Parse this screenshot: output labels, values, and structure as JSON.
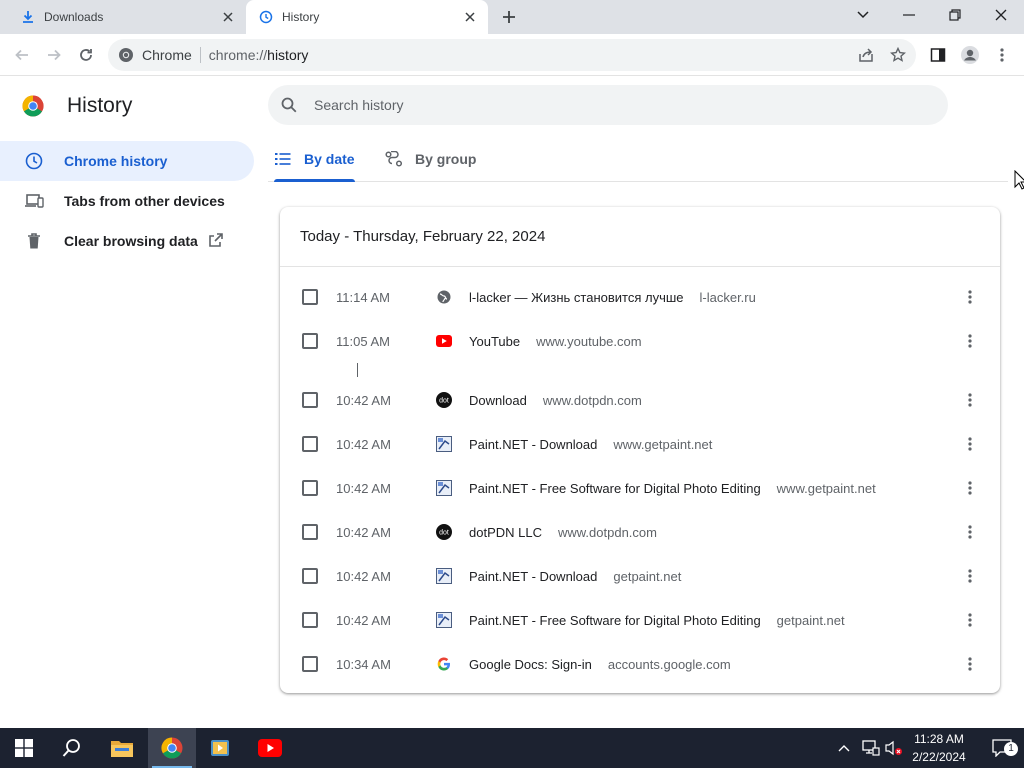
{
  "browser": {
    "tabs": [
      {
        "title": "Downloads",
        "icon": "download-icon",
        "active": false
      },
      {
        "title": "History",
        "icon": "history-icon",
        "active": true
      }
    ],
    "omnibox": {
      "chip": "Chrome",
      "url_scheme": "chrome://",
      "url_host": "history"
    }
  },
  "sidebar": {
    "title": "History",
    "items": [
      {
        "label": "Chrome history",
        "icon": "clock-icon",
        "selected": true
      },
      {
        "label": "Tabs from other devices",
        "icon": "devices-icon",
        "selected": false
      },
      {
        "label": "Clear browsing data",
        "icon": "trash-icon",
        "selected": false
      }
    ]
  },
  "search": {
    "placeholder": "Search history"
  },
  "view_tabs": [
    {
      "label": "By date",
      "icon": "list-icon",
      "active": true
    },
    {
      "label": "By group",
      "icon": "group-icon",
      "active": false
    }
  ],
  "history": {
    "header": "Today - Thursday, February 22, 2024",
    "entries": [
      {
        "time": "11:14 AM",
        "title": "l-lacker — Жизнь становится лучше",
        "domain": "l-lacker.ru",
        "favicon": "globe-icon"
      },
      {
        "time": "11:05 AM",
        "title": "YouTube",
        "domain": "www.youtube.com",
        "favicon": "youtube-icon"
      },
      {
        "time": "10:42 AM",
        "title": "Download",
        "domain": "www.dotpdn.com",
        "favicon": "dotpdn-icon"
      },
      {
        "time": "10:42 AM",
        "title": "Paint.NET - Download",
        "domain": "www.getpaint.net",
        "favicon": "paintnet-icon"
      },
      {
        "time": "10:42 AM",
        "title": "Paint.NET - Free Software for Digital Photo Editing",
        "domain": "www.getpaint.net",
        "favicon": "paintnet-icon"
      },
      {
        "time": "10:42 AM",
        "title": "dotPDN LLC",
        "domain": "www.dotpdn.com",
        "favicon": "dotpdn-icon"
      },
      {
        "time": "10:42 AM",
        "title": "Paint.NET - Download",
        "domain": "getpaint.net",
        "favicon": "paintnet-icon"
      },
      {
        "time": "10:42 AM",
        "title": "Paint.NET - Free Software for Digital Photo Editing",
        "domain": "getpaint.net",
        "favicon": "paintnet-icon"
      },
      {
        "time": "10:34 AM",
        "title": "Google Docs: Sign-in",
        "domain": "accounts.google.com",
        "favicon": "google-icon"
      }
    ]
  },
  "taskbar": {
    "clock_time": "11:28 AM",
    "clock_date": "2/22/2024",
    "notification_count": "1"
  },
  "colors": {
    "accent": "#1a5fd0",
    "selected_bg": "#e8f0fe",
    "taskbar": "#1c2230"
  }
}
